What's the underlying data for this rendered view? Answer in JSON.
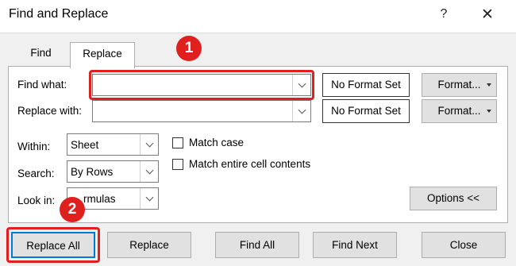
{
  "window": {
    "title": "Find and Replace",
    "help_symbol": "?",
    "close_symbol": "✕"
  },
  "tabs": {
    "find": "Find",
    "replace": "Replace"
  },
  "find_what": {
    "label": "Find what:",
    "value": ""
  },
  "replace_with": {
    "label": "Replace with:",
    "value": ""
  },
  "format_set": {
    "find": "No Format Set",
    "replace": "No Format Set"
  },
  "format_button": {
    "label": "Format...",
    "menu_symbol": "▾"
  },
  "within": {
    "label": "Within:",
    "value": "Sheet"
  },
  "search": {
    "label": "Search:",
    "value": "By Rows"
  },
  "look_in": {
    "label": "Look in:",
    "value": "Formulas",
    "visible_value": "rmulas"
  },
  "options": {
    "match_case": "Match case",
    "match_entire": "Match entire cell contents",
    "match_case_checked": false,
    "match_entire_checked": false
  },
  "options_button": "Options <<",
  "buttons": {
    "replace_all": "Replace All",
    "replace": "Replace",
    "find_all": "Find All",
    "find_next": "Find Next",
    "close": "Close"
  },
  "annotations": {
    "badge1": "1",
    "badge2": "2",
    "color": "#e0201e"
  },
  "icons": {
    "help": "help-icon",
    "close": "close-icon",
    "dropdown": "chevron-down-icon"
  }
}
